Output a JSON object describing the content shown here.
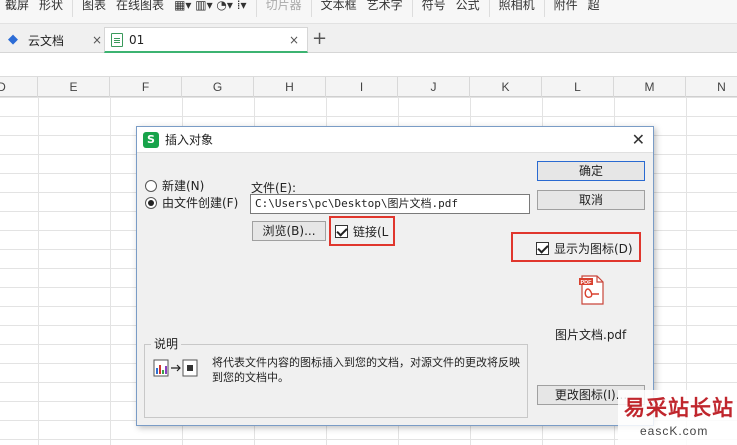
{
  "ribbon": {
    "items": [
      "截屏",
      "形状",
      "图表",
      "在线图表",
      "切片器",
      "文本框",
      "艺术字",
      "符号",
      "公式",
      "照相机",
      "附件",
      "超"
    ]
  },
  "tabs": {
    "cloud": "云文档",
    "doc": "01",
    "close_glyph": "×",
    "new_tab": "+"
  },
  "columns": [
    "D",
    "E",
    "F",
    "G",
    "H",
    "I",
    "J",
    "K",
    "L",
    "M",
    "N"
  ],
  "dialog": {
    "title": "插入对象",
    "radio_new": "新建(N)",
    "radio_from_file": "由文件创建(F)",
    "file_label": "文件(E):",
    "file_path": "C:\\Users\\pc\\Desktop\\图片文档.pdf",
    "browse": "浏览(B)...",
    "link": "链接(L",
    "link_checked": true,
    "show_as_icon": "显示为图标(D)",
    "show_as_icon_checked": true,
    "ok": "确定",
    "cancel": "取消",
    "icon_caption": "图片文档.pdf",
    "change_icon": "更改图标(I)...",
    "desc_title": "说明",
    "desc_text": "将代表文件内容的图标插入到您的文档，对源文件的更改将反映到您的文档中。",
    "highlight_color": "#e0362d"
  },
  "watermark": {
    "title": "易采站长站",
    "url": "eascK.com"
  }
}
